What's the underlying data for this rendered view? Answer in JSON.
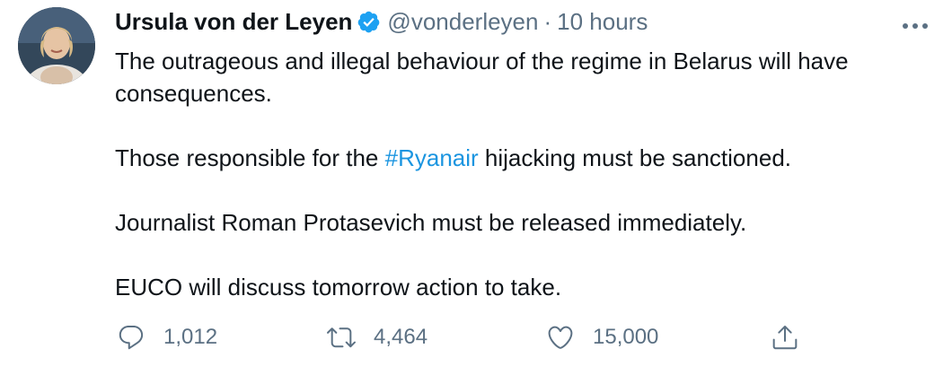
{
  "author": {
    "display_name": "Ursula von der Leyen",
    "handle": "@vonderleyen",
    "separator": "·",
    "time": "10 hours",
    "verified": true
  },
  "text": {
    "line1_part1": "The outrageous and illegal behaviour of the regime in Belarus will have",
    "line1_part2": "consequences.",
    "line2_before": "Those responsible for the ",
    "line2_hashtag": "#Ryanair",
    "line2_after": " hijacking must be sanctioned.",
    "line3": "Journalist Roman Protasevich must be released immediately.",
    "line4": "EUCO will discuss tomorrow action to take."
  },
  "actions": {
    "replies": "1,012",
    "retweets": "4,464",
    "likes": "15,000"
  },
  "icons": {
    "verified": "verified-badge-icon",
    "more": "more-options-icon",
    "reply": "reply-icon",
    "retweet": "retweet-icon",
    "like": "heart-icon",
    "share": "share-icon"
  },
  "colors": {
    "text": "#0f1419",
    "secondary": "#5b7083",
    "link": "#1b95e0",
    "verified": "#1da1f2"
  }
}
